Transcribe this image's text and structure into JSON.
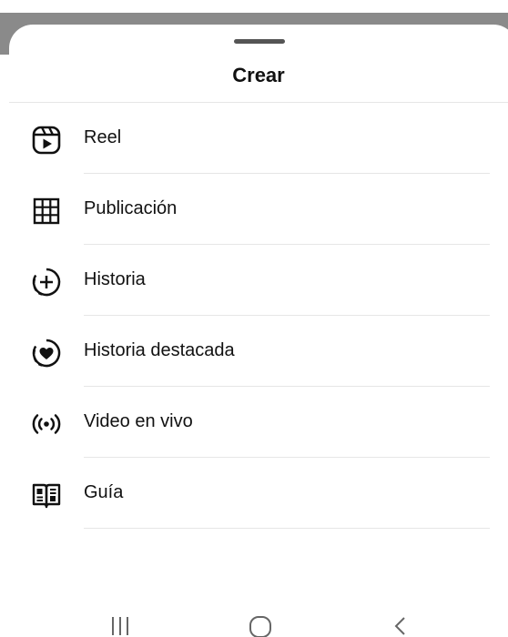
{
  "sheet": {
    "title": "Crear"
  },
  "menu": {
    "items": [
      {
        "label": "Reel",
        "icon": "reels-icon"
      },
      {
        "label": "Publicación",
        "icon": "grid-post-icon"
      },
      {
        "label": "Historia",
        "icon": "add-story-icon"
      },
      {
        "label": "Historia destacada",
        "icon": "story-highlight-heart-icon"
      },
      {
        "label": "Video en vivo",
        "icon": "live-broadcast-icon"
      },
      {
        "label": "Guía",
        "icon": "guide-book-icon"
      }
    ]
  },
  "navbar": {
    "buttons": [
      "recent-apps",
      "home",
      "back"
    ]
  },
  "colors": {
    "text": "#111111",
    "divider": "#e6e6e6",
    "backdrop": "#8a8a8a",
    "nav_icon": "#666666"
  }
}
